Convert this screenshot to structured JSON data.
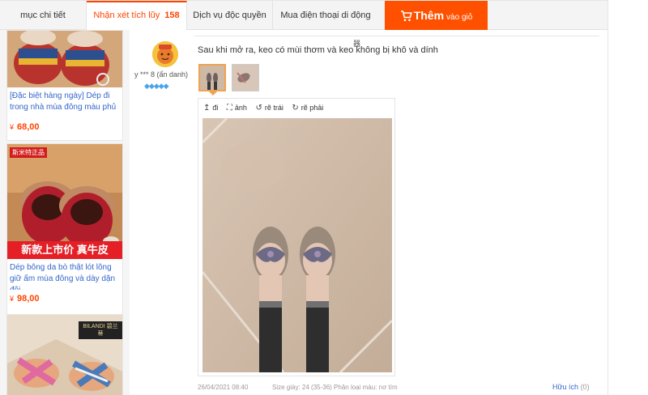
{
  "tabs": {
    "details": "mục chi tiết",
    "reviews": "Nhận xét tích lũy",
    "reviews_count": "158",
    "services": "Dịch vụ độc quyền",
    "mobile": "Mua điện thoại di động"
  },
  "cart_button": {
    "main": "Thêm",
    "sub": "vào giỏ",
    "color": "#ff5000"
  },
  "sidebar_products": [
    {
      "name": "[Đặc biệt hàng ngày] Dép đi trong nhà mùa đông màu phủ",
      "currency": "¥",
      "price": "68,00"
    },
    {
      "banner": "新款上市价 真牛皮",
      "auth_tag": "斯米特正品",
      "name": "Dép bông da bò thật lót lông giữ ấm mùa đông và dày dặn đôi",
      "currency": "¥",
      "price": "98,00"
    },
    {
      "brand": "BILANDI 碧兰蒂"
    }
  ],
  "review": {
    "user": "y *** 8 (ẩn danh)",
    "diamonds": "◆◆◆◆◆",
    "text": "Sau khi mở ra, keo có mùi thơm và keo không bị khô và dính",
    "qr_mark": "器",
    "toolbar": [
      {
        "icon": "rotate-icon",
        "glyph": "↥",
        "label": "đi"
      },
      {
        "icon": "expand-icon",
        "glyph": "⛶",
        "label": "ảnh"
      },
      {
        "icon": "rotate-left-icon",
        "glyph": "↺",
        "label": "rẽ trái"
      },
      {
        "icon": "rotate-right-icon",
        "glyph": "↻",
        "label": "rẽ phải"
      }
    ],
    "date": "26/04/2021 08:40",
    "spec": "Size giày: 24 (35-36) Phân loại màu: nơ tím",
    "helpful_label": "Hữu ích",
    "helpful_count": "(0)"
  },
  "colors": {
    "accent": "#ff4400",
    "link": "#3366cc",
    "price": "#ff4400"
  }
}
